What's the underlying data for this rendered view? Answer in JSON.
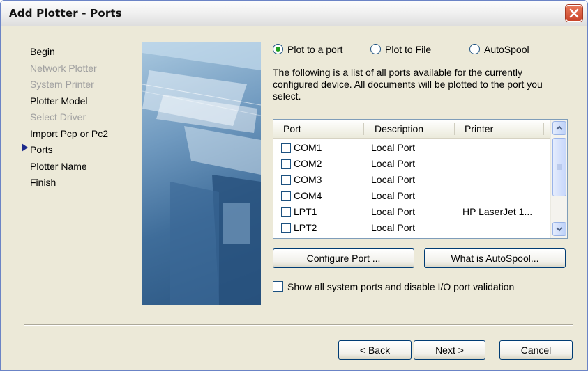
{
  "window": {
    "title": "Add Plotter - Ports"
  },
  "steps": [
    {
      "label": "Begin",
      "enabled": true
    },
    {
      "label": "Network Plotter",
      "enabled": false
    },
    {
      "label": "System Printer",
      "enabled": false
    },
    {
      "label": "Plotter Model",
      "enabled": true
    },
    {
      "label": "Select Driver",
      "enabled": false
    },
    {
      "label": "Import Pcp or Pc2",
      "enabled": true
    },
    {
      "label": "Ports",
      "enabled": true,
      "current": true
    },
    {
      "label": "Plotter Name",
      "enabled": true
    },
    {
      "label": "Finish",
      "enabled": true
    }
  ],
  "options": {
    "plot_to_port": "Plot to a port",
    "plot_to_file": "Plot to File",
    "autospool": "AutoSpool",
    "selected": "Plot to a port"
  },
  "description": "The following is a list of all ports available for the currently configured device. All documents will be plotted to the port you select.",
  "ports_table": {
    "headers": [
      "Port",
      "Description",
      "Printer"
    ],
    "rows": [
      {
        "port": "COM1",
        "description": "Local Port",
        "printer": ""
      },
      {
        "port": "COM2",
        "description": "Local Port",
        "printer": ""
      },
      {
        "port": "COM3",
        "description": "Local Port",
        "printer": ""
      },
      {
        "port": "COM4",
        "description": "Local Port",
        "printer": ""
      },
      {
        "port": "LPT1",
        "description": "Local Port",
        "printer": "HP LaserJet 1..."
      },
      {
        "port": "LPT2",
        "description": "Local Port",
        "printer": ""
      }
    ]
  },
  "buttons": {
    "configure_port": "Configure Port ...",
    "what_is_autospool": "What is AutoSpool...",
    "back": "< Back",
    "next": "Next >",
    "cancel": "Cancel"
  },
  "show_all_ports": {
    "label": "Show all system ports and disable I/O port validation",
    "checked": false
  },
  "colors": {
    "accent": "#003c74",
    "close": "#c9442a",
    "radio_selected": "#21a121"
  }
}
